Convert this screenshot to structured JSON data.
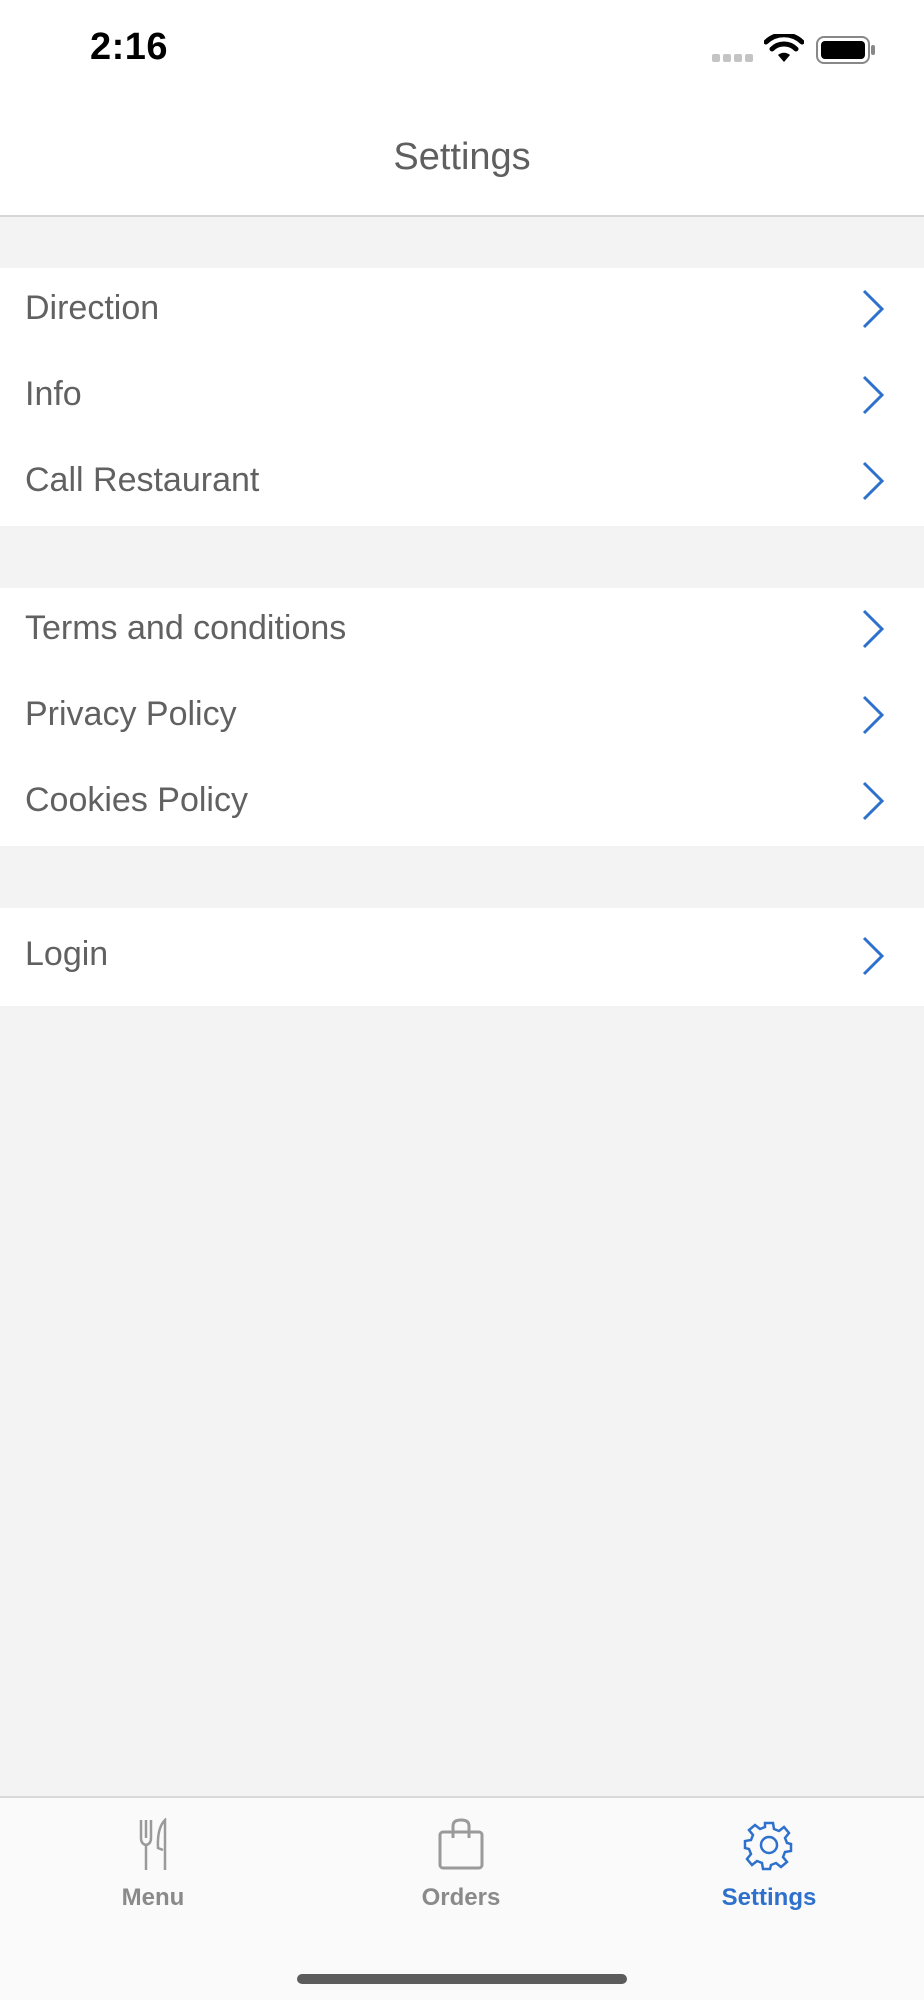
{
  "status_bar": {
    "time": "2:16"
  },
  "nav": {
    "title": "Settings"
  },
  "groups": [
    {
      "items": [
        {
          "label": "Direction"
        },
        {
          "label": "Info"
        },
        {
          "label": "Call Restaurant"
        }
      ]
    },
    {
      "items": [
        {
          "label": "Terms and conditions"
        },
        {
          "label": "Privacy Policy"
        },
        {
          "label": "Cookies Policy"
        }
      ]
    },
    {
      "items": [
        {
          "label": "Login"
        }
      ]
    }
  ],
  "tab_bar": {
    "tabs": [
      {
        "label": "Menu",
        "icon": "fork-knife-icon",
        "active": false
      },
      {
        "label": "Orders",
        "icon": "shopping-bag-icon",
        "active": false
      },
      {
        "label": "Settings",
        "icon": "gear-icon",
        "active": true
      }
    ]
  },
  "colors": {
    "accent": "#2e71cc",
    "text": "#616161",
    "background": "#f3f3f3",
    "inactive_tab": "#8a8a8a"
  }
}
